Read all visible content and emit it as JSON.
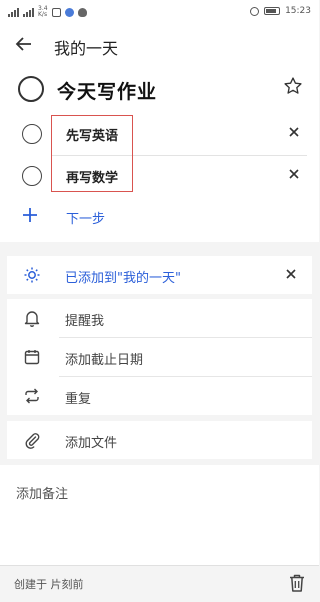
{
  "statusbar": {
    "speed_value": "3.4",
    "speed_unit": "K/s",
    "time": "15:23"
  },
  "appbar": {
    "title": "我的一天"
  },
  "task": {
    "title": "今天写作业"
  },
  "steps": [
    {
      "label": "先写英语"
    },
    {
      "label": "再写数学"
    }
  ],
  "add_step": {
    "label": "下一步"
  },
  "my_day": {
    "label": "已添加到\"我的一天\""
  },
  "options": {
    "remind": "提醒我",
    "due_date": "添加截止日期",
    "repeat": "重复",
    "attach": "添加文件"
  },
  "note": {
    "placeholder": "添加备注"
  },
  "footer": {
    "created": "创建于 片刻前"
  },
  "colors": {
    "accent": "#2b5fd9",
    "highlight_box": "#d9534f"
  }
}
